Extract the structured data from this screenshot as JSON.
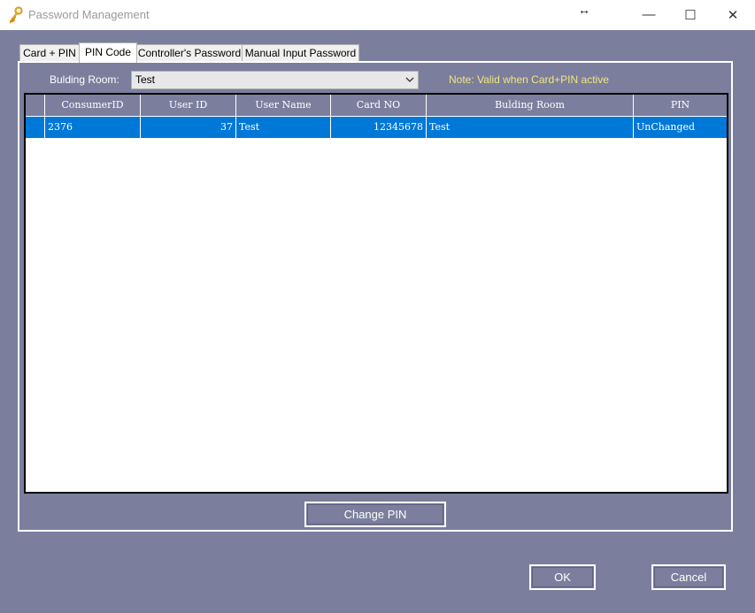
{
  "window": {
    "title": "Password Management",
    "minimize": "—",
    "maximize": "☐",
    "close": "✕",
    "resize_cursor": "↔"
  },
  "tabs": [
    {
      "label": "Card + PIN"
    },
    {
      "label": "PIN Code"
    },
    {
      "label": "Controller's Password"
    },
    {
      "label": "Manual Input Password"
    }
  ],
  "filter": {
    "label": "Bulding Room:",
    "value": "Test",
    "note": "Note:  Valid when Card+PIN active"
  },
  "grid": {
    "columns": [
      "ConsumerID",
      "User ID",
      "User Name",
      "Card NO",
      "Bulding Room",
      "PIN"
    ],
    "rows": [
      [
        "2376",
        "37",
        "Test",
        "12345678",
        "Test",
        "UnChanged"
      ]
    ]
  },
  "buttons": {
    "change_pin": "Change PIN",
    "ok": "OK",
    "cancel": "Cancel"
  },
  "colors": {
    "background": "#7b7f9d",
    "selection": "#0078d7",
    "note": "#f3e57c"
  }
}
